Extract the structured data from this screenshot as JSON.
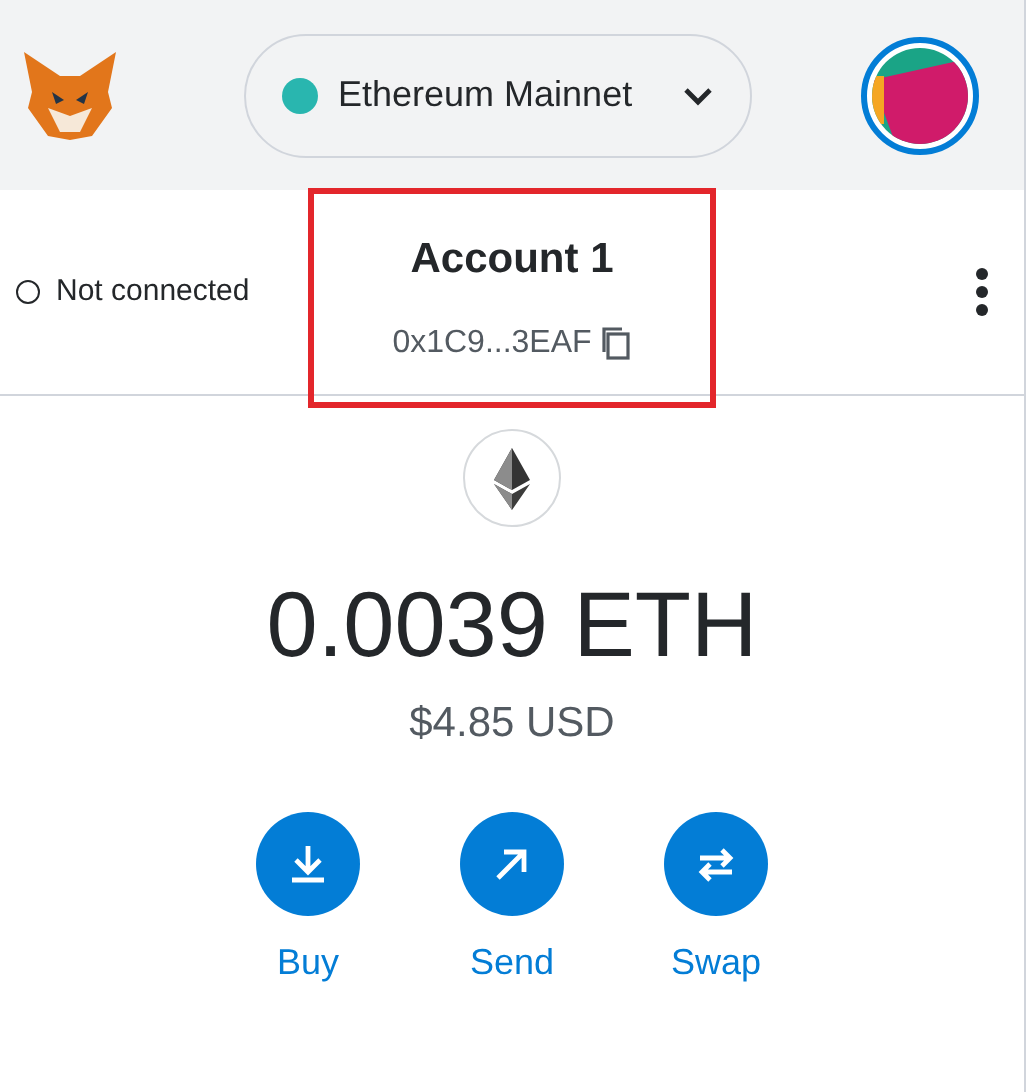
{
  "network": {
    "label": "Ethereum Mainnet",
    "color": "#29b6af"
  },
  "connection": {
    "label": "Not connected"
  },
  "account": {
    "name": "Account 1",
    "address": "0x1C9...3EAF",
    "highlighted": true
  },
  "balance": {
    "primary": "0.0039 ETH",
    "secondary": "$4.85 USD"
  },
  "actions": [
    {
      "label": "Buy",
      "kind": "buy"
    },
    {
      "label": "Send",
      "kind": "send"
    },
    {
      "label": "Swap",
      "kind": "swap"
    }
  ]
}
